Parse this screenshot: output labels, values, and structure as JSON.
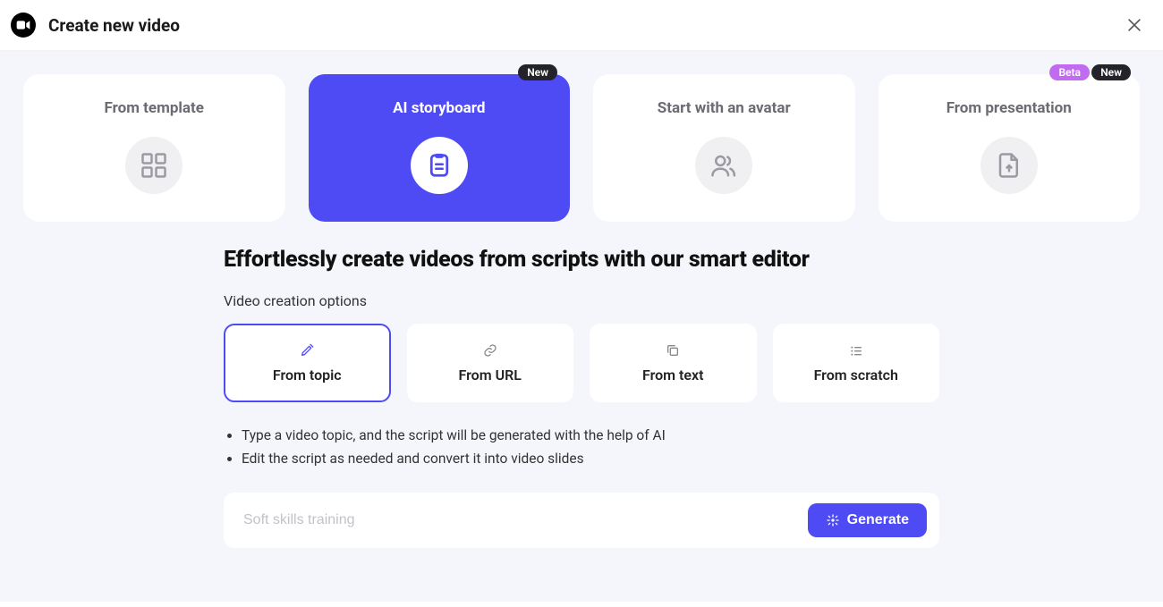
{
  "header": {
    "title": "Create new video"
  },
  "cards": [
    {
      "title": "From template",
      "badge": null,
      "badge2": null
    },
    {
      "title": "AI storyboard",
      "badge": "New",
      "badge2": null
    },
    {
      "title": "Start with an avatar",
      "badge": null,
      "badge2": null
    },
    {
      "title": "From presentation",
      "badge": "New",
      "badge2": "Beta"
    }
  ],
  "main": {
    "headline": "Effortlessly create videos from scripts with our smart editor",
    "subhead": "Video creation options",
    "options": [
      {
        "label": "From topic"
      },
      {
        "label": "From URL"
      },
      {
        "label": "From text"
      },
      {
        "label": "From scratch"
      }
    ],
    "bullets": [
      "Type a video topic, and the script will be generated with the help of AI",
      "Edit the script as needed and convert it into video slides"
    ],
    "input": {
      "placeholder": "Soft skills training",
      "value": ""
    },
    "generate_label": "Generate"
  }
}
